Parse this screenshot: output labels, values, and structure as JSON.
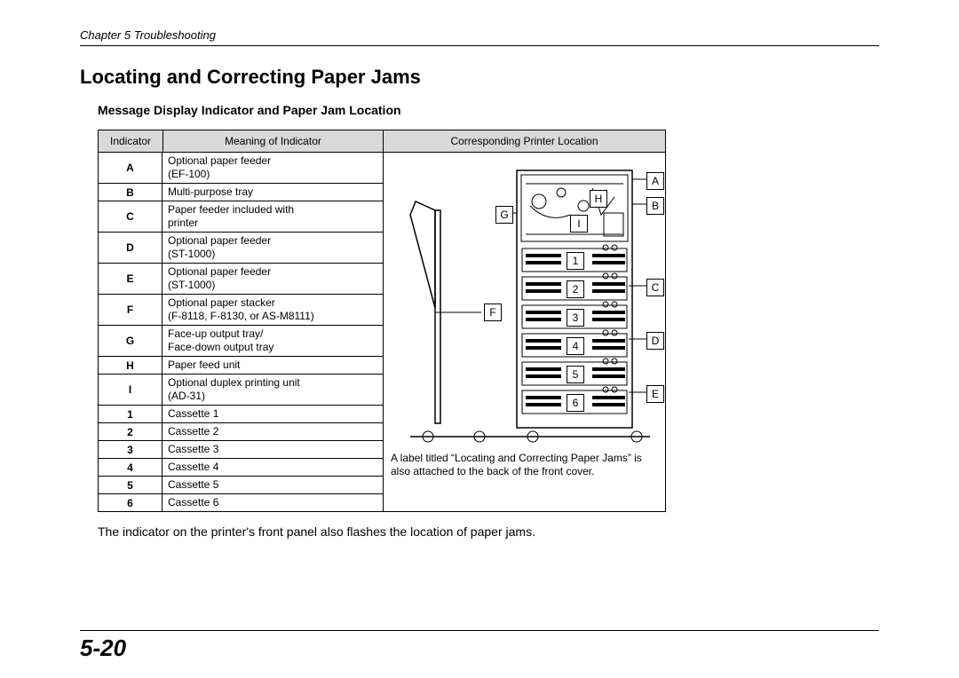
{
  "chapter": "Chapter 5  Troubleshooting",
  "title": "Locating and Correcting Paper Jams",
  "subtitle": "Message Display Indicator and Paper Jam Location",
  "headers": {
    "indicator": "Indicator",
    "meaning": "Meaning of Indicator",
    "location": "Corresponding Printer Location"
  },
  "rows": [
    {
      "ind": "A",
      "mean": "Optional paper feeder\n(EF-100)"
    },
    {
      "ind": "B",
      "mean": "Multi-purpose tray"
    },
    {
      "ind": "C",
      "mean": "Paper feeder included with\nprinter"
    },
    {
      "ind": "D",
      "mean": "Optional paper feeder\n(ST-1000)"
    },
    {
      "ind": "E",
      "mean": "Optional paper feeder\n(ST-1000)"
    },
    {
      "ind": "F",
      "mean": "Optional paper stacker\n(F-8118, F-8130, or AS-M8111)"
    },
    {
      "ind": "G",
      "mean": "Face-up output tray/\nFace-down output tray"
    },
    {
      "ind": "H",
      "mean": "Paper feed unit"
    },
    {
      "ind": "I",
      "mean": "Optional duplex printing unit\n(AD-31)"
    },
    {
      "ind": "1",
      "mean": "Cassette 1"
    },
    {
      "ind": "2",
      "mean": "Cassette 2"
    },
    {
      "ind": "3",
      "mean": "Cassette 3"
    },
    {
      "ind": "4",
      "mean": "Cassette 4"
    },
    {
      "ind": "5",
      "mean": "Cassette 5"
    },
    {
      "ind": "6",
      "mean": "Cassette 6"
    }
  ],
  "diagram": {
    "labels": {
      "A": "A",
      "B": "B",
      "C": "C",
      "D": "D",
      "E": "E",
      "F": "F",
      "G": "G",
      "H": "H",
      "I": "I",
      "n1": "1",
      "n2": "2",
      "n3": "3",
      "n4": "4",
      "n5": "5",
      "n6": "6"
    },
    "note": "A label titled “Locating and Correcting Paper Jams” is also attached to the back of the front cover."
  },
  "bodytext": "The indicator on the printer's front panel also flashes the location of paper jams.",
  "pagenum": "5-20"
}
